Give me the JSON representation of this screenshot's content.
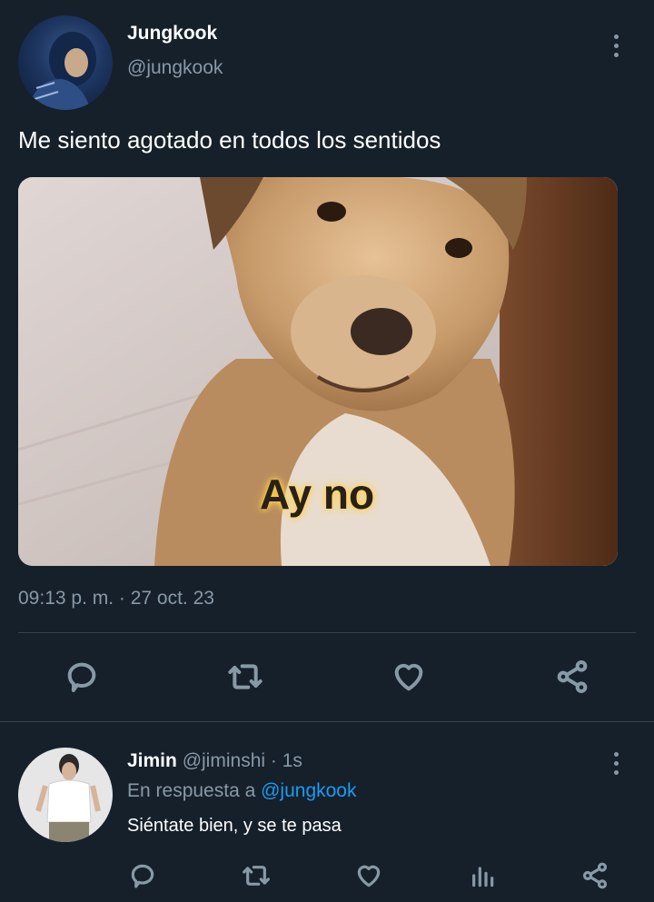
{
  "tweet": {
    "author_name": "Jungkook",
    "author_handle": "@jungkook",
    "text": "Me siento agotado en todos los sentidos",
    "image_caption": "Ay no",
    "timestamp": "09:13 p. m. · 27 oct. 23",
    "actions": [
      "reply-icon",
      "retweet-icon",
      "like-icon",
      "share-icon"
    ]
  },
  "reply": {
    "author_name": "Jimin",
    "author_handle": "@jiminshi",
    "time": "· 1s",
    "in_reply_prefix": "En respuesta a",
    "in_reply_handle": "@jungkook",
    "text": "Siéntate bien, y se te pasa",
    "actions": [
      "reply-icon",
      "retweet-icon",
      "like-icon",
      "analytics-icon",
      "share-icon"
    ]
  },
  "colors": {
    "background": "#15202b",
    "muted": "#8899a6",
    "link": "#1d9bf0",
    "divider": "#38444d"
  }
}
